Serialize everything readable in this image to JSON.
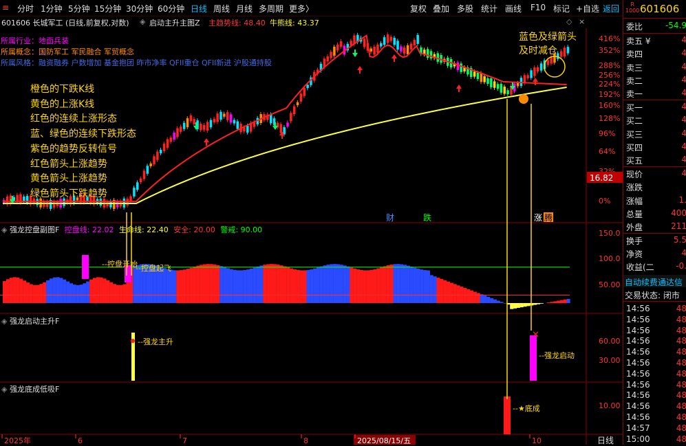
{
  "toolbar": {
    "menu_icon": "≡",
    "periods": [
      "分时",
      "1分钟",
      "5分钟",
      "15分钟",
      "30分钟",
      "60分钟",
      "日线",
      "周线",
      "月线",
      "多周期",
      "更多〉"
    ],
    "right": [
      "复权",
      "叠加",
      "多股",
      "统计",
      "画线",
      "F10",
      "标记",
      "+自选",
      "返回"
    ]
  },
  "chart_title": {
    "code_name": "601606 长城军工 (日线,前复权,对数)",
    "indicator_name": "启动主升主图Z",
    "line1_label": "主趋势线: 48.40",
    "line2_label": "牛熊线: 43.37"
  },
  "concepts": [
    {
      "label": "所属行业：地面兵装",
      "color": "#ff00ff"
    },
    {
      "label": "所属概念：国防军工  军民融合  军贸概念",
      "color": "#ff8c00"
    },
    {
      "label": "所属风格：融资融券 户数增加 基金抱团 昨市净率 QFII重仓 QFII新进 沪股通持股",
      "color": "#4169e1"
    }
  ],
  "annotations": [
    "橙色的下跌K线",
    "黄色的上涨K线",
    "红色的连续上涨形态",
    "蓝、绿色的连续下跌形态",
    "紫色的趋势反转信号",
    "红色箭头上涨趋势",
    "黄色箭头上涨趋势",
    "绿色箭头下跌趋势"
  ],
  "callout": [
    "蓝色及绿箭头",
    "及时减仓"
  ],
  "main_axis": [
    "416%",
    "352%",
    "288%",
    "256%",
    "224%",
    "192%",
    "160%",
    "128%",
    "96%",
    "64%",
    "32%",
    "0%"
  ],
  "price_tag": "16.82",
  "markers": {
    "cai": "财",
    "die": "跌",
    "zhang": "涨",
    "teng": "腾"
  },
  "sub1": {
    "title": "强龙控盘副图F",
    "labels": [
      {
        "t": "控盘线: 22.02",
        "c": "#ff00ff"
      },
      {
        "t": "生命线: 22.40",
        "c": "#ffff00"
      },
      {
        "t": "安全: 20.00",
        "c": "#ff3333"
      },
      {
        "t": "警戒: 90.00",
        "c": "#00ff00"
      }
    ],
    "axis": [
      "150.0",
      "100.0",
      "50.00"
    ],
    "notes": [
      "控盘开始",
      "控盘起飞"
    ]
  },
  "sub2": {
    "title": "强龙启动主升F",
    "axis": [
      "60.00",
      "30.00"
    ],
    "notes": [
      "强龙主升",
      "强龙启动"
    ]
  },
  "sub3": {
    "title": "强龙底成低吸F",
    "axis": [
      "10.00"
    ],
    "notes": [
      "★底成"
    ]
  },
  "xaxis": [
    "2025年",
    "6",
    "7",
    "8",
    "2025/08/15/五",
    "10"
  ],
  "corner": "日线",
  "right_panel": {
    "badge_top": "R",
    "badge_bottom": "1000",
    "stock_code": "601606",
    "weibi_label": "委比",
    "weibi_value": "-54.9",
    "sell": [
      {
        "l": "卖五 ¥",
        "v": "4"
      },
      {
        "l": "卖四",
        "v": "4"
      },
      {
        "l": "卖三",
        "v": "4"
      },
      {
        "l": "卖二",
        "v": "4"
      },
      {
        "l": "卖一",
        "v": "4"
      }
    ],
    "buy": [
      {
        "l": "买一",
        "v": "4"
      },
      {
        "l": "买二",
        "v": "4"
      },
      {
        "l": "买三",
        "v": "4"
      },
      {
        "l": "买四",
        "v": "4"
      },
      {
        "l": "买五",
        "v": "4"
      }
    ],
    "stats": [
      {
        "l": "现价",
        "v": "4"
      },
      {
        "l": "涨跌",
        "v": ""
      },
      {
        "l": "涨幅",
        "v": "1."
      },
      {
        "l": "总量",
        "v": "400"
      },
      {
        "l": "外盘",
        "v": "211"
      },
      {
        "l": "换手",
        "v": "5.5"
      },
      {
        "l": "净资",
        "v": "4"
      },
      {
        "l": "收益(二",
        "v": "-0."
      }
    ],
    "notice": "自动续费通达信",
    "trade_status": "交易状态: 闭市",
    "ticks": [
      {
        "t": "14:56",
        "v": "48"
      },
      {
        "t": "14:56",
        "v": "48"
      },
      {
        "t": "14:56",
        "v": "48"
      },
      {
        "t": "14:56",
        "v": "48"
      },
      {
        "t": "14:56",
        "v": "48"
      },
      {
        "t": "14:56",
        "v": "48"
      },
      {
        "t": "14:56",
        "v": "48"
      },
      {
        "t": "14:56",
        "v": "48"
      },
      {
        "t": "14:56",
        "v": "48"
      },
      {
        "t": "14:56",
        "v": "48"
      },
      {
        "t": "14:56",
        "v": "48"
      },
      {
        "t": "14:57",
        "v": "48"
      },
      {
        "t": "15:00",
        "v": "48"
      }
    ]
  }
}
